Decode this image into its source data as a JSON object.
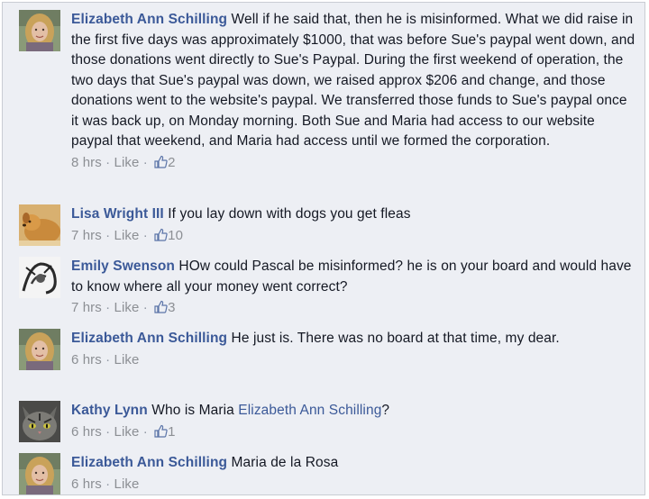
{
  "comments": [
    {
      "author": "Elizabeth Ann Schilling",
      "text": "Well if he said that, then he is misinformed. What we did raise in the first five days was approximately $1000, that was before Sue's paypal went down, and those donations went directly to Sue's Paypal. During the first weekend of operation, the two days that Sue's paypal was down, we raised approx $206 and change, and those donations went to the website's paypal. We transferred those funds to Sue's paypal once it was back up, on Monday morning. Both Sue and Maria had access to our website paypal that weekend, and Maria had access until we formed the corporation.",
      "time": "8 hrs",
      "like_label": "Like",
      "likes": "2",
      "avatar": "woman-portrait-avatar"
    },
    {
      "author": "Lisa Wright III",
      "text": "If you lay down with dogs you get fleas",
      "time": "7 hrs",
      "like_label": "Like",
      "likes": "10",
      "avatar": "dog-avatar"
    },
    {
      "author": "Emily Swenson",
      "text": "HOw could Pascal be misinformed? he is on your board and would have to know where all your money went correct?",
      "time": "7 hrs",
      "like_label": "Like",
      "likes": "3",
      "avatar": "sketch-avatar"
    },
    {
      "author": "Elizabeth Ann Schilling",
      "text": "He just is. There was no board at that time, my dear.",
      "time": "6 hrs",
      "like_label": "Like",
      "avatar": "woman-portrait-avatar"
    },
    {
      "author": "Kathy Lynn",
      "text_before": "Who is Maria ",
      "mention": "Elizabeth Ann Schilling",
      "text_after": "?",
      "time": "6 hrs",
      "like_label": "Like",
      "likes": "1",
      "avatar": "cat-avatar"
    },
    {
      "author": "Elizabeth Ann Schilling",
      "text": "Maria de la Rosa",
      "time": "6 hrs",
      "like_label": "Like",
      "avatar": "woman-portrait-avatar"
    }
  ],
  "separator": "·",
  "colors": {
    "background": "#edeff4",
    "author_link": "#3b5998",
    "meta_text": "#8c8f94",
    "body_text": "#141823"
  }
}
